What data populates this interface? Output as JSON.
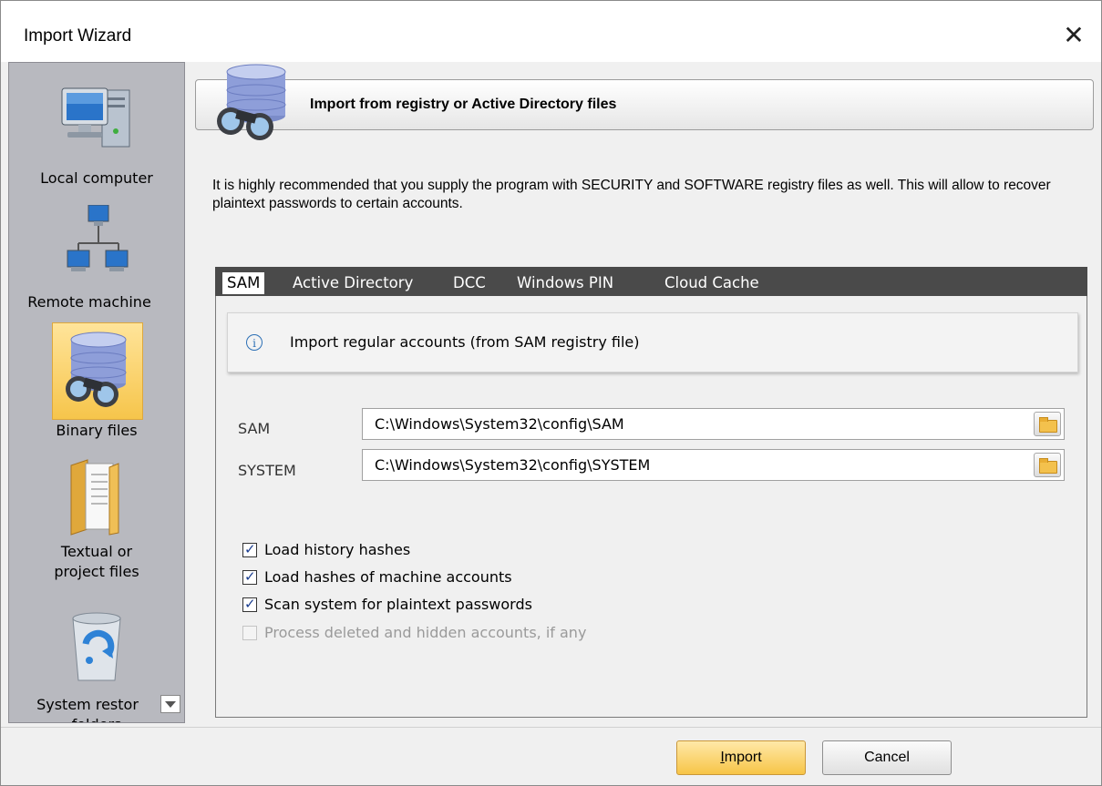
{
  "window": {
    "title": "Import Wizard",
    "close_glyph": "✕"
  },
  "sidebar": {
    "items": [
      {
        "label": "Local computer",
        "icon": "computer-icon"
      },
      {
        "label": "Remote machine",
        "icon": "network-icon"
      },
      {
        "label": "Binary files",
        "icon": "database-binoculars-icon",
        "active": true
      },
      {
        "label_lines": [
          "Textual or",
          "project files"
        ],
        "icon": "folder-document-icon"
      },
      {
        "label_lines": [
          "System restor",
          "folders"
        ],
        "icon": "recycle-bin-icon"
      }
    ]
  },
  "header": {
    "title": "Import from registry or Active Directory files",
    "icon": "database-binoculars-icon"
  },
  "description": "It is highly recommended that you supply the program with SECURITY and SOFTWARE registry files as well. This will allow to recover plaintext passwords to certain accounts.",
  "tabs": [
    {
      "label": "SAM",
      "active": true
    },
    {
      "label": "Active Directory"
    },
    {
      "label": "DCC"
    },
    {
      "label": "Windows PIN"
    },
    {
      "label": "Cloud Cache"
    }
  ],
  "info": {
    "icon": "info-icon",
    "text": "Import regular accounts (from SAM registry file)"
  },
  "fields": [
    {
      "label": "SAM",
      "value": "C:\\Windows\\System32\\config\\SAM"
    },
    {
      "label": "SYSTEM",
      "value": "C:\\Windows\\System32\\config\\SYSTEM"
    }
  ],
  "checkboxes": [
    {
      "label": "Load history hashes",
      "checked": true,
      "enabled": true
    },
    {
      "label": "Load hashes of machine accounts",
      "checked": true,
      "enabled": true
    },
    {
      "label": "Scan system for plaintext passwords",
      "checked": true,
      "enabled": true
    },
    {
      "label": "Process deleted and hidden accounts, if any",
      "checked": false,
      "enabled": false
    }
  ],
  "buttons": {
    "import_label": "Import",
    "import_mnemonic": "I",
    "import_rest": "mport",
    "cancel_label": "Cancel"
  }
}
